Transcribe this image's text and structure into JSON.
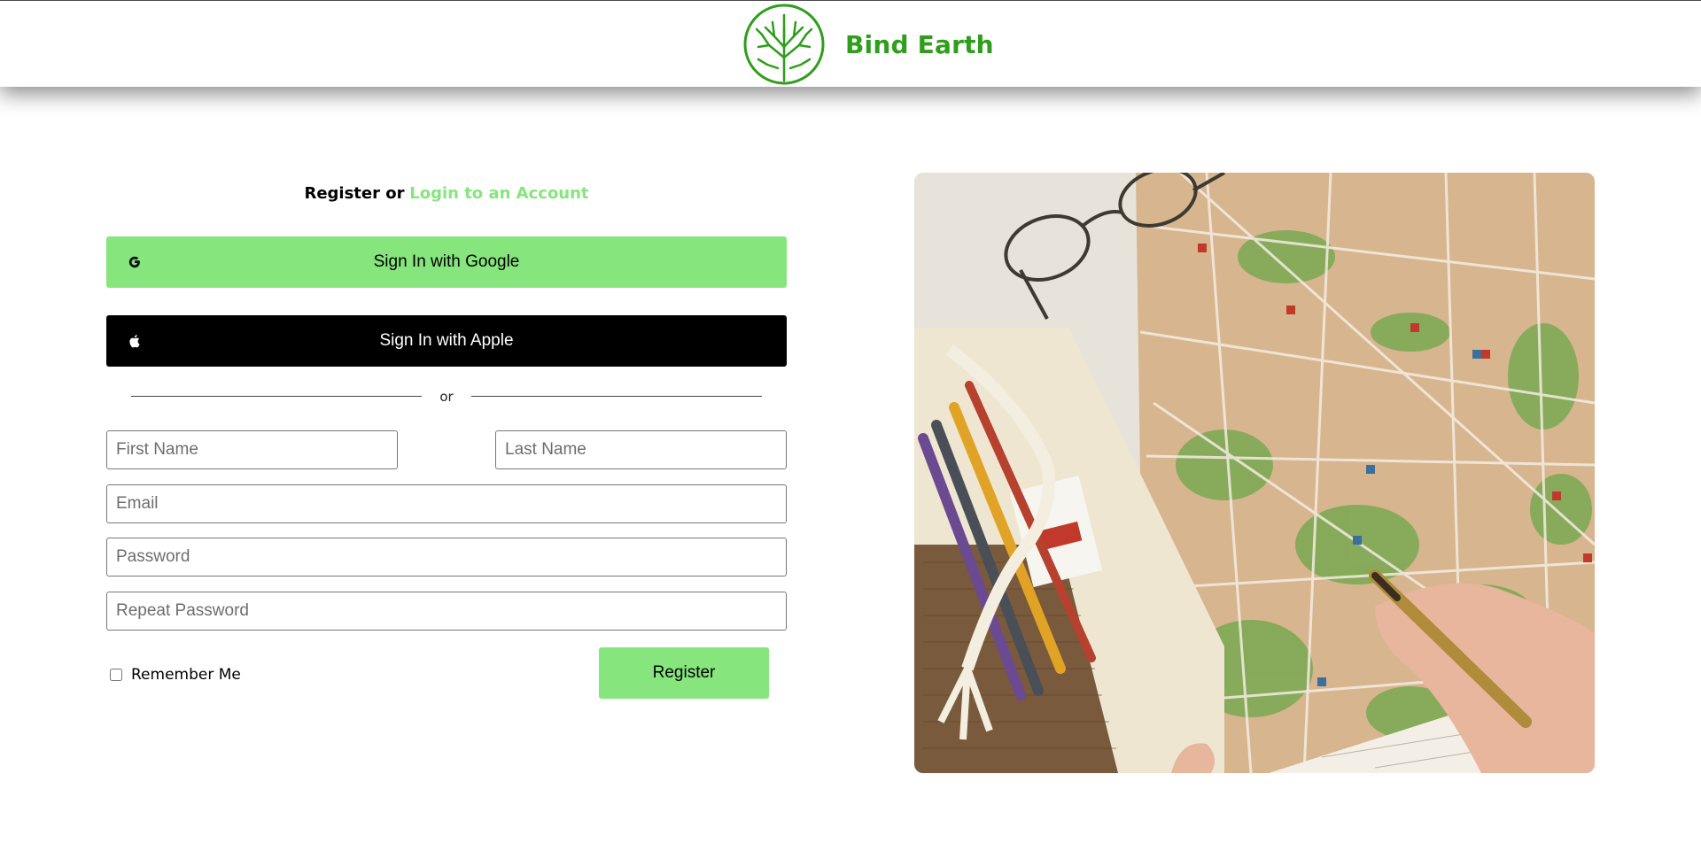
{
  "header": {
    "brand_name": "Bind Earth",
    "logo_icon": "tree-circle-icon",
    "brand_color": "#2f9e1c"
  },
  "auth": {
    "prefix": "Register or",
    "login_link": "Login to an Account",
    "link_color": "#86e57d",
    "google_button": "Sign In with Google",
    "google_icon": "google-g-icon",
    "apple_button": "Sign In with Apple",
    "apple_icon": "apple-icon",
    "divider_text": "or",
    "accent_color": "#86e57d"
  },
  "form": {
    "first_name_placeholder": "First Name",
    "last_name_placeholder": "Last Name",
    "email_placeholder": "Email",
    "password_placeholder": "Password",
    "repeat_password_placeholder": "Repeat Password",
    "remember_label": "Remember Me",
    "register_button": "Register"
  },
  "hero": {
    "image_subject": "map-with-pencils-glasses-and-hand-illustration"
  }
}
